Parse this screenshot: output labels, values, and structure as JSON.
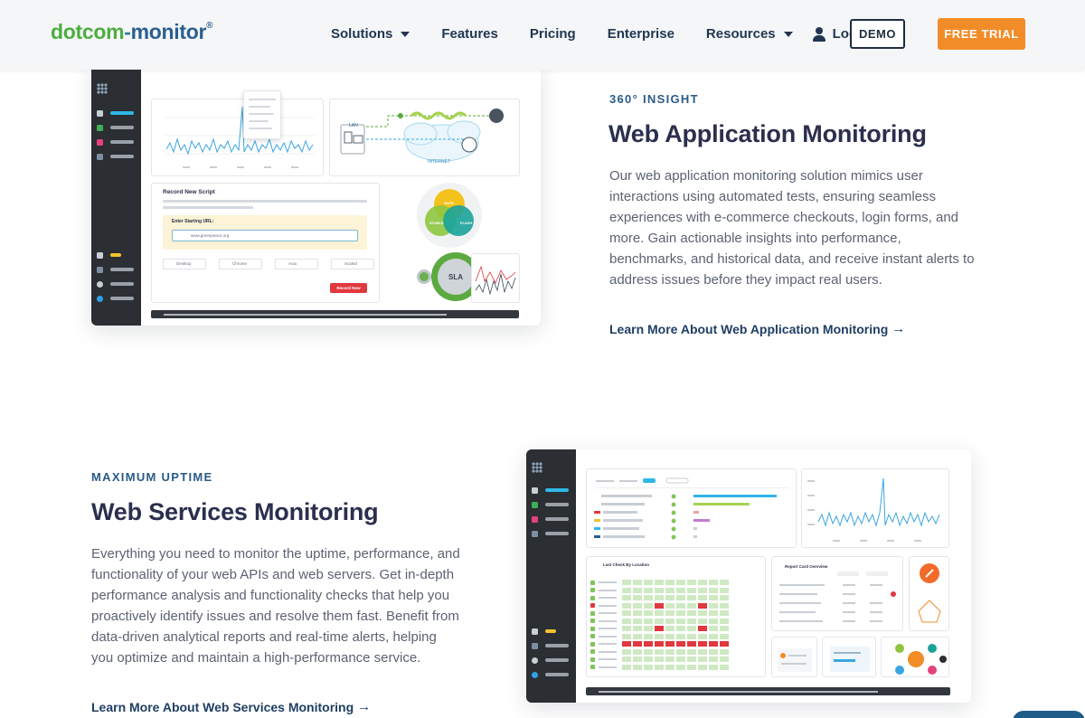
{
  "logo": {
    "part1": "dotcom",
    "part2": "-",
    "part3": "monitor",
    "mark": "®"
  },
  "nav": {
    "solutions": "Solutions",
    "features": "Features",
    "pricing": "Pricing",
    "enterprise": "Enterprise",
    "resources": "Resources",
    "login": "Login"
  },
  "buttons": {
    "demo": "DEMO",
    "trial": "FREE TRIAL"
  },
  "section1": {
    "eyebrow": "360° INSIGHT",
    "title": "Web Application Monitoring",
    "body": "Our web application monitoring solution mimics user interactions using automated tests, ensuring seamless experiences with e-commerce checkouts, login forms, and more. Gain actionable insights into performance, benchmarks, and historical data, and receive instant alerts to address issues before they impact real users.",
    "link": "Learn More About Web Application Monitoring",
    "mock": {
      "script_title": "Record New Script",
      "url_label": "Enter Starting URL:",
      "url_value": "www.greenpeace.org",
      "record_button": "Record Now",
      "lan": "LAN",
      "internet": "INTERNET",
      "sla": "SLA",
      "venn": [
        "SAFE",
        "STABLE",
        "FLASH"
      ],
      "device_options": [
        "Desktop",
        "Chrome",
        "Auto",
        "Scaled"
      ]
    }
  },
  "section2": {
    "eyebrow": "MAXIMUM UPTIME",
    "title": "Web Services Monitoring",
    "body": "Everything you need to monitor the uptime, performance, and functionality of your web APIs and web servers. Get in-depth performance analysis and functionality checks that help you proactively identify issues and resolve them fast. Benefit from data-driven analytical reports and real-time alerts, helping you optimize and maintain a high-performance service.",
    "link": "Learn More About Web Services Monitoring",
    "mock": {
      "panel_title_1": "Last Check By Location",
      "panel_title_2": "Report Card Overview"
    }
  },
  "icons": {
    "arrow": "arrow-right-icon",
    "caret": "chevron-down-icon",
    "user": "user-icon"
  },
  "colors": {
    "brand_green": "#4cae3f",
    "brand_blue": "#2a5f8f",
    "accent_orange": "#f28c28",
    "heading": "#2b2f4e",
    "status_red": "#e0383e",
    "status_green": "#7ec65a"
  }
}
